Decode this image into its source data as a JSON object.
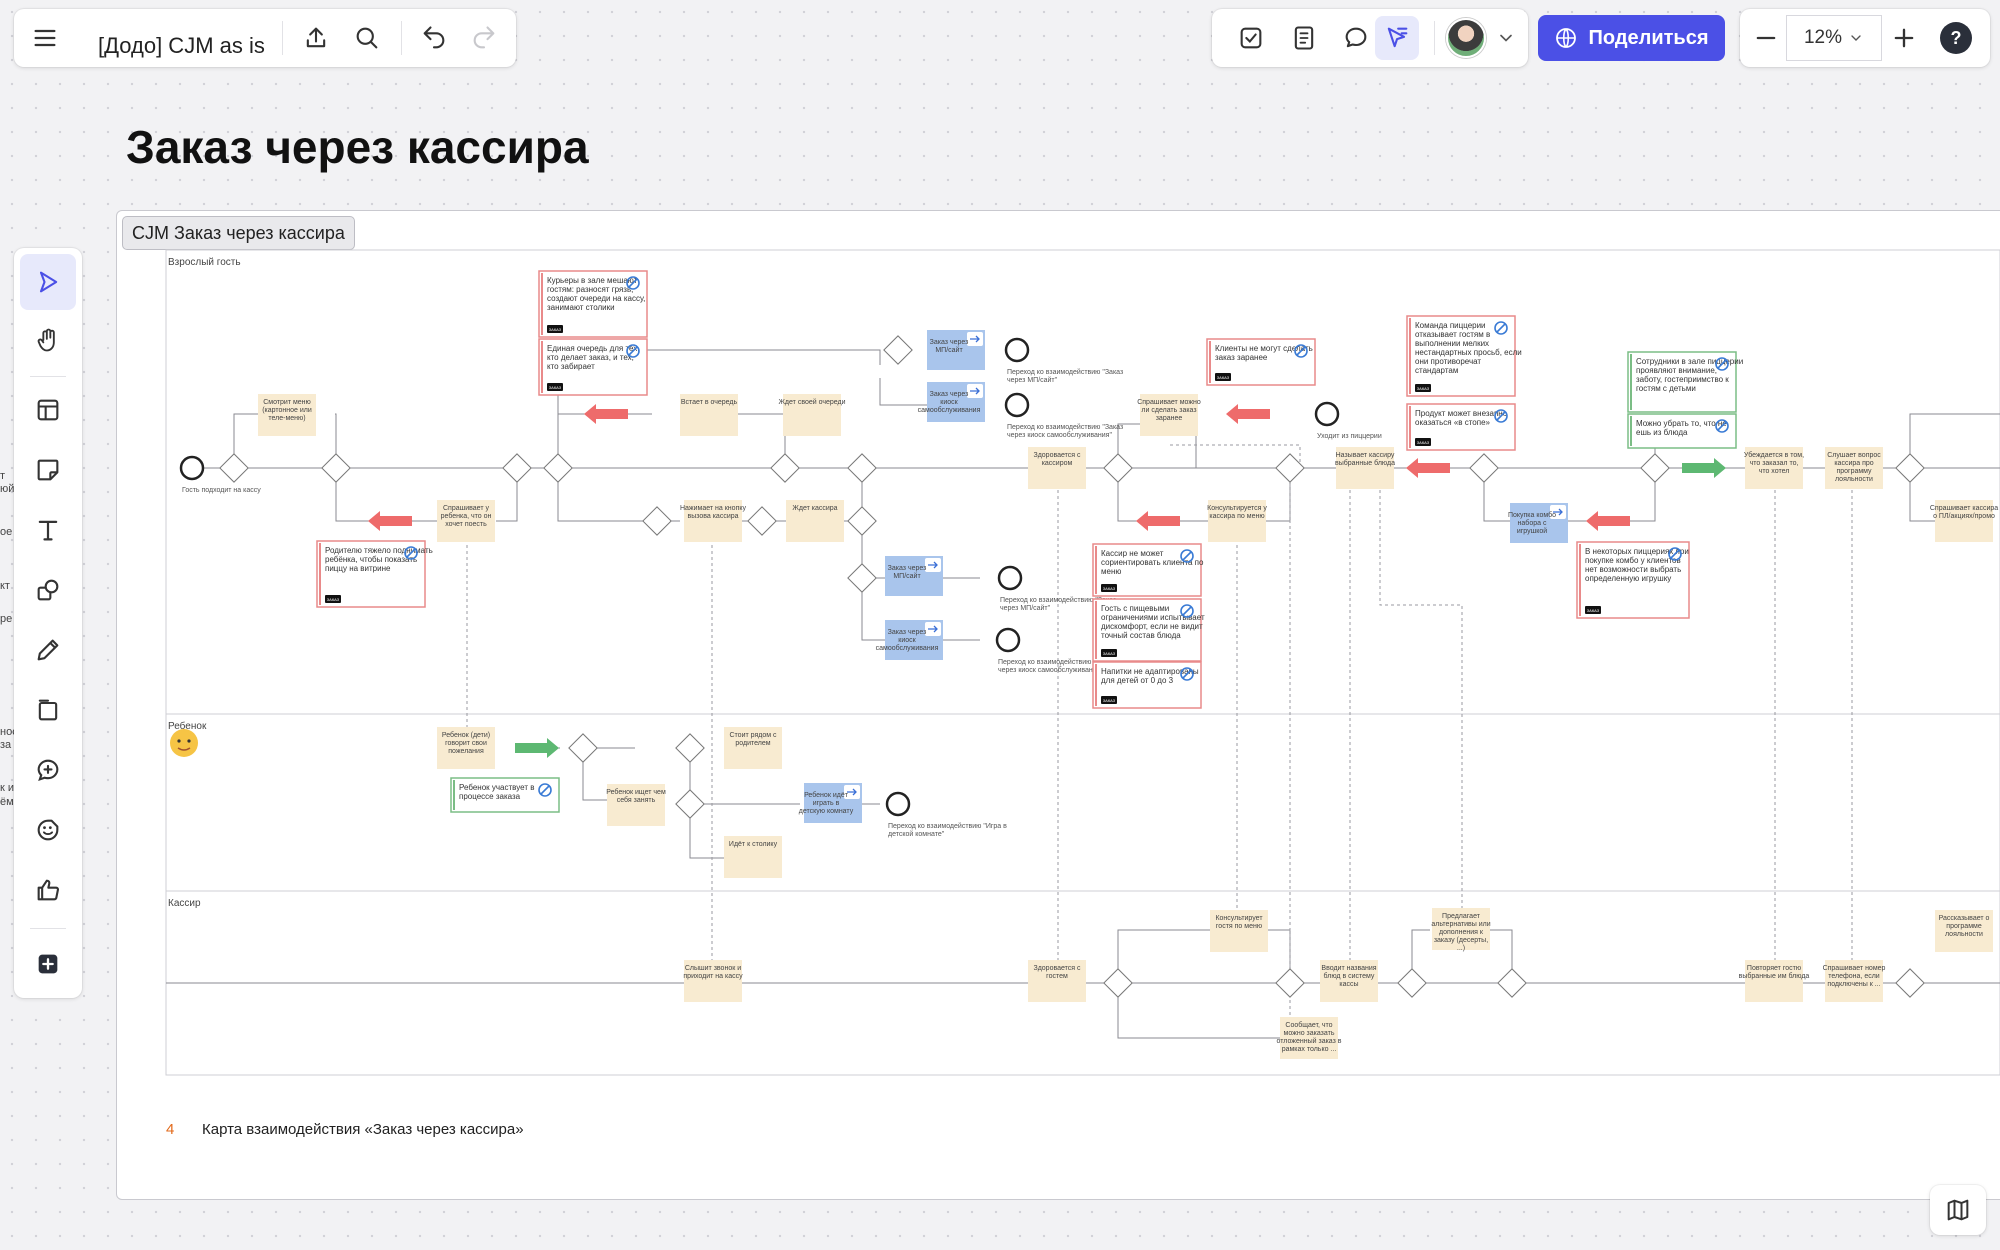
{
  "toolbar": {
    "doc_title": "[Додо] CJM as is",
    "share_label": "Поделиться",
    "zoom": "12%",
    "help": "?"
  },
  "canvas": {
    "page_title": "Заказ через кассира",
    "frame_label": "CJM Заказ через кассира",
    "page_number": "4",
    "page_caption": "Карта взаимодействия «Заказ через кассира»"
  },
  "lanes": {
    "adult": "Взрослый гость",
    "child": "Ребенок",
    "cashier": "Кассир"
  },
  "left_edge_fragments": [
    "т",
    "юй",
    "ое",
    "кт",
    "ре",
    "нос",
    "за",
    "к и",
    "ём"
  ],
  "tasks": [
    "Смотрит меню (картонное или теле-меню)",
    "Спрашивает у ребенка, что он хочет поесть",
    "Встает в очередь",
    "Ждет своей очереди",
    "Нажимает на кнопку вызова кассира",
    "Ждет кассира",
    "Здоровается с кассиром",
    "Спрашивает можно ли сделать заказ заранее",
    "Консультируется у кассира по меню",
    "Называет кассиру выбранные блюда",
    "Убеждается в том, что заказал то, что хотел",
    "Слушает вопрос кассира про программу лояльности",
    "Спрашивает кассира о ПЛ/акциях/промо",
    "Ребенок (дети) говорит свои пожелания",
    "Стоит рядом с родителем",
    "Ребенок ищет чем себя занять",
    "Идёт к столику",
    "Слышит звонок и приходит на кассу",
    "Здоровается с гостем",
    "Консультирует гостя по меню",
    "Вводит названия блюд в систему кассы",
    "Предлагает альтернативы или дополнения к заказу (десерты, ...)",
    "Сообщает, что можно заказать отложенный заказ в рамках только ...",
    "Повторяет гостю выбранные им блюда",
    "Спрашивает номер телефона, если подключены к ...",
    "Рассказывает о программе лояльности"
  ],
  "blue_tasks": [
    "Заказ через МП/сайт",
    "Заказ через киоск самообслуживания",
    "Заказ через МП/сайт",
    "Заказ через киоск самообслуживания",
    "Ребенок идёт играть в детскую комнату",
    "Покупка комбо набора с игрушкой"
  ],
  "notes": [
    "Курьеры в зале мешают гостям: разносят грязь, создают очереди на кассу, занимают столики",
    "Единая очередь для тех, кто делает заказ, и тех, кто забирает",
    "Родителю тяжело поднимать ребёнка, чтобы показать пиццу на витрине",
    "Клиенты не могут сделать заказ заранее",
    "Команда пиццерии отказывает гостям в выполнении мелких нестандартных просьб, если они противоречат стандартам",
    "Продукт может внезапно оказаться «в стопе»",
    "Кассир не может сориентировать клиента по меню",
    "Гость с пищевыми ограничениями испытывает дискомфорт, если не видит точный состав блюда",
    "Напитки не адаптированы для детей от 0 до 3",
    "В некоторых пиццериях при покупке комбо у клиентов нет возможности выбрать определенную игрушку",
    "Сотрудники в зале пиццерии проявляют внимание, заботу, гостеприимство к гостям с детьми",
    "Можно убрать то, что не ешь из блюда",
    "Ребенок участвует в процессе заказа"
  ],
  "note_tag": "ЗАКАЗ",
  "end_labels": [
    "Гость подходит на кассу",
    "Переход ко взаимодействию \"Заказ через МП/сайт\"",
    "Переход ко взаимодействию \"Заказ через киоск самообслуживания\"",
    "Переход ко взаимодействию \"Заказ через МП/сайт\"",
    "Переход ко взаимодействию \"Заказ через киоск самообслуживания\"",
    "Переход ко взаимодействию \"Игра в детской комнате\"",
    "Уходит из пиццерии"
  ],
  "colors": {
    "accent": "#4b50e6",
    "task": "#f8ebd1",
    "blue_task": "#a9c5ec",
    "pain_arrow": "#ee6b6b",
    "gain_arrow": "#5db872",
    "page_num": "#e26a1b"
  },
  "icons": {
    "menu": "hamburger-icon",
    "export": "upload-icon",
    "search": "search-icon",
    "undo": "undo-icon",
    "redo": "redo-icon",
    "tasks": "checkbox-icon",
    "notes": "document-icon",
    "comments": "comment-icon",
    "cursor": "cursor-arrow-icon",
    "globe": "globe-icon",
    "minus": "minus-icon",
    "plus": "plus-icon",
    "select": "pointer-icon",
    "hand": "hand-icon",
    "template": "template-icon",
    "sticky": "sticky-note-icon",
    "text": "text-icon",
    "shapes": "shapes-icon",
    "pen": "pen-icon",
    "frame": "frame-icon",
    "comment_add": "comment-add-icon",
    "sticker": "sticker-icon",
    "like": "thumb-up-icon",
    "more": "add-icon",
    "map": "map-icon"
  }
}
